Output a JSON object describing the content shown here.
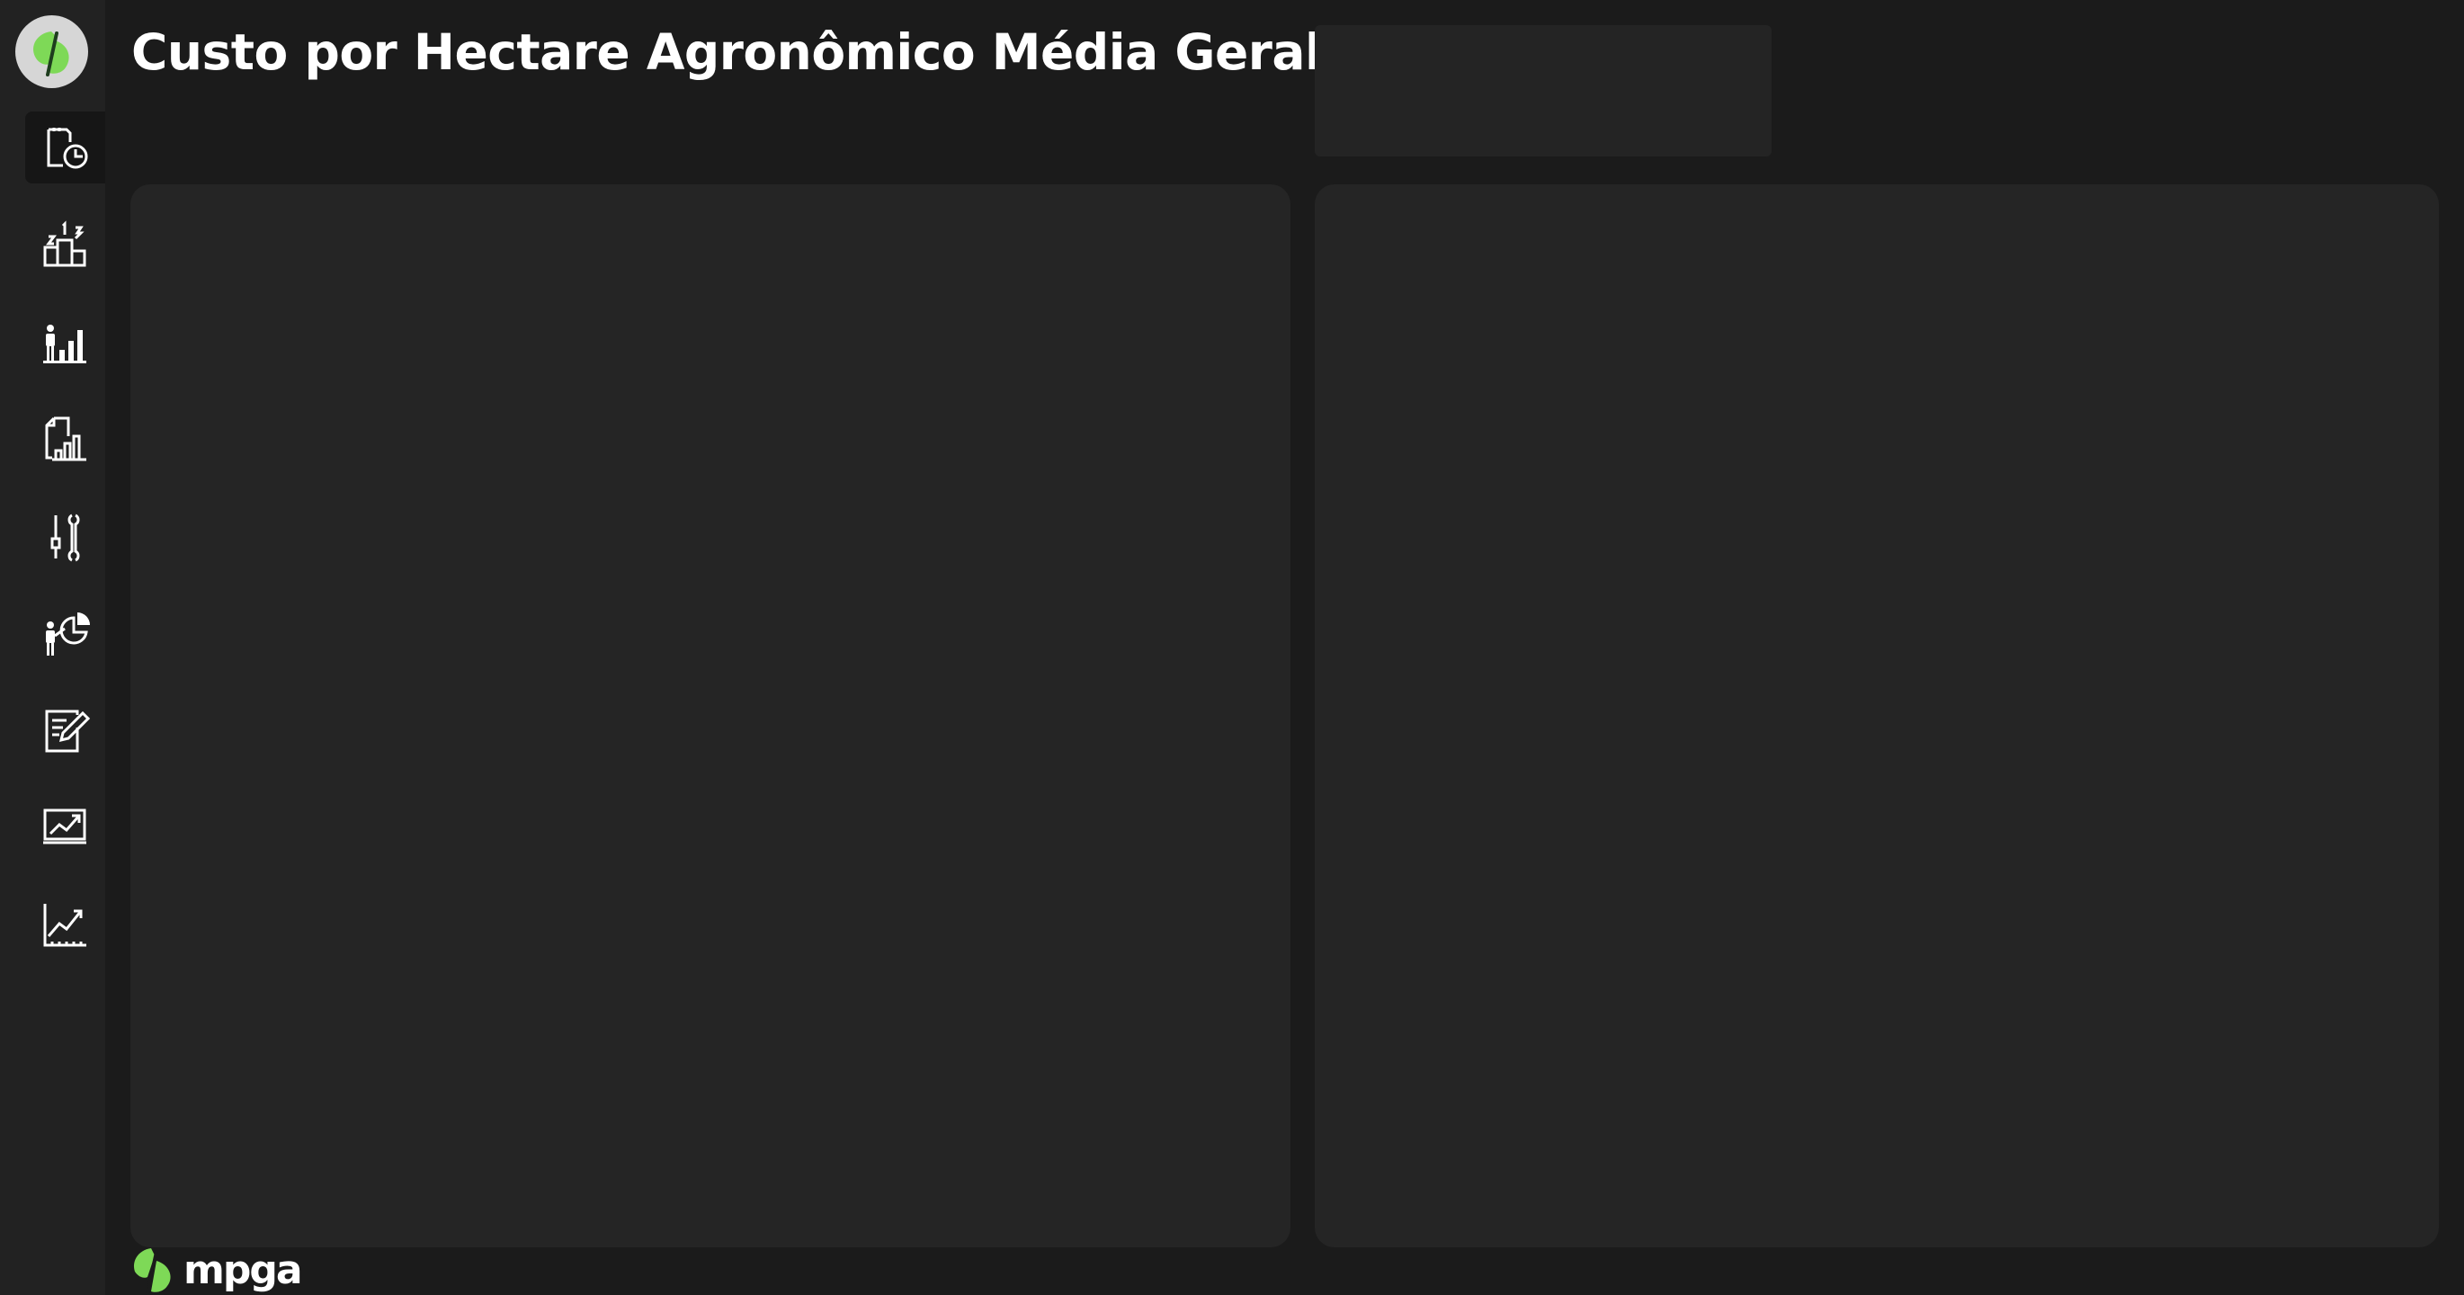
{
  "page": {
    "title": "Custo por Hectare Agronômico Média Geral"
  },
  "footer": {
    "brand_text": "mpga"
  },
  "sidebar": {
    "items": [
      {
        "icon": "report-clock-icon",
        "active": true
      },
      {
        "icon": "podium-ranking-icon",
        "active": false
      },
      {
        "icon": "person-bar-chart-icon",
        "active": false
      },
      {
        "icon": "document-bar-chart-icon",
        "active": false
      },
      {
        "icon": "tools-icon",
        "active": false
      },
      {
        "icon": "person-pie-chart-icon",
        "active": false
      },
      {
        "icon": "edit-document-icon",
        "active": false
      },
      {
        "icon": "monitor-trend-icon",
        "active": false
      },
      {
        "icon": "line-chart-trend-icon",
        "active": false
      }
    ]
  },
  "colors": {
    "background": "#1b1b1b",
    "sidebar": "#222222",
    "panel": "#252525",
    "brand_green": "#7ed957",
    "brand_dark_green": "#2f7a2f"
  }
}
